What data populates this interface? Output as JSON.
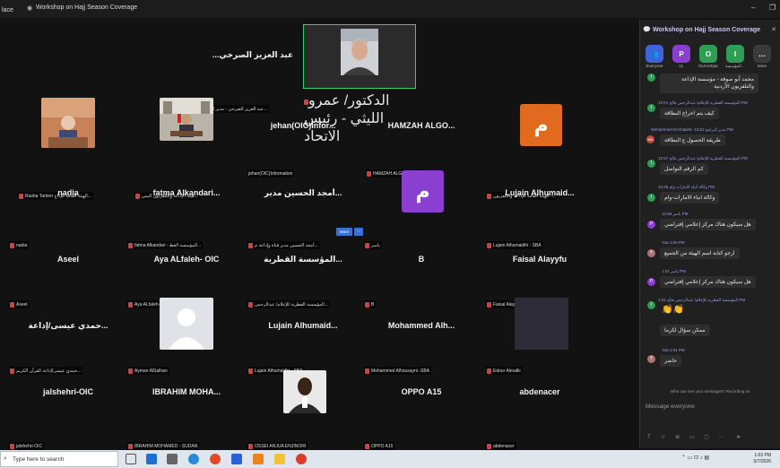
{
  "titlebar": {
    "app_name": "lace",
    "title": "Workshop on Hajj Season Coverage",
    "minimize": "–",
    "maximize": "❐"
  },
  "pinned": {
    "name": "الدكتور/ عمرو الليثي - رئيس الاتحاد"
  },
  "top_left": {
    "name": "...عبد العزيز الصرخي",
    "foot": "عبد العزيز الصرخي - مدير الشاد..."
  },
  "tiles": [
    {
      "id": "rasha",
      "name": "",
      "foot": "Rasha Tarteer الهيئة العامة للإذاع..."
    },
    {
      "id": "radio",
      "name": "",
      "foot": "هيئة الإذاعة والتلفزيون اليمن..."
    },
    {
      "id": "jehan",
      "name": "jehan(OIC)Infor...",
      "foot": "jehan(OIC)Information"
    },
    {
      "id": "hamzah",
      "name": "HAMZAH  ALGO...",
      "foot": "HAMZAH ALGOBAISHI"
    },
    {
      "id": "hayaa",
      "name": "",
      "foot": "الهيئة العامة للإذاعة والتلفزيون -..."
    },
    {
      "id": "nadia",
      "name": "nadia",
      "foot": "nadia"
    },
    {
      "id": "fatma",
      "name": "fatma  Alkandari...",
      "foot": "fatma Alkandari - المؤسسة العط..."
    },
    {
      "id": "amjad",
      "name": "أمجد الحسين مدير...",
      "foot": "أمجد الحسين مدير قناة وإذاعة م..."
    },
    {
      "id": "yasir",
      "name": "",
      "foot": "ياسر"
    },
    {
      "id": "lujain1",
      "name": "Lujain  Alhumaid...",
      "foot": "Lujain Alhumaidhi - SBA"
    },
    {
      "id": "aseel",
      "name": "Aseel",
      "foot": "Aseel"
    },
    {
      "id": "aya",
      "name": "Aya  ALfaleh-  OIC",
      "foot": "Aya ALfaleh- OIC"
    },
    {
      "id": "qatar",
      "name": "المؤسسة  القطرية...",
      "foot": "المؤسسة القطرية للإعلام/ عبدالرحمن..."
    },
    {
      "id": "b",
      "name": "B",
      "foot": "B"
    },
    {
      "id": "faisal",
      "name": "Faisal  Alayyfu",
      "foot": "Faisal Alayyfu"
    },
    {
      "id": "hamdi",
      "name": "حمدي  عيسى/إذاعة...",
      "foot": "حمدي عيسى/إذاعة القرآن الكريم..."
    },
    {
      "id": "ayman",
      "name": "",
      "foot": "Ayman AlSalhan"
    },
    {
      "id": "lujain2",
      "name": "Lujain  Alhumaid...",
      "foot": "Lujain Alhumaidhi - SBA"
    },
    {
      "id": "mohammed",
      "name": "Mohammed  Alh...",
      "foot": "Mohammed Alhousayni -SBA"
    },
    {
      "id": "edour",
      "name": "",
      "foot": "Edour Almalki"
    },
    {
      "id": "jalshehri",
      "name": "jalshehri-OIC",
      "foot": "jalshehri-OIC"
    },
    {
      "id": "ibrahim",
      "name": "IBRAHIM  MOHA...",
      "foot": "IBRAHIM MOHAMED - SUDAN"
    },
    {
      "id": "ossei",
      "name": "",
      "foot": "OSSEI ANJUA ENJINORI"
    },
    {
      "id": "oppo",
      "name": "OPPO  A15",
      "foot": "OPPO A15"
    },
    {
      "id": "abdenacer",
      "name": "abdenacer",
      "foot": "abdenacer"
    }
  ],
  "avatars": {
    "hayaa": "م",
    "yasir": "م"
  },
  "more_badge": "More",
  "panel": {
    "title": "Workshop on Hajj Season Coverage",
    "tabs": [
      {
        "letter": "",
        "label": "Everyone",
        "color": "#3f63d9"
      },
      {
        "letter": "P",
        "label": "يانا",
        "color": "#8a3fd1"
      },
      {
        "letter": "O",
        "label": "OUALIDjed...",
        "color": "#2e9e55"
      },
      {
        "letter": "I",
        "label": "المؤسسة ...",
        "color": "#2e9e55"
      },
      {
        "letter": "…",
        "label": "More",
        "color": "#3a3a3a"
      }
    ],
    "messages": [
      {
        "meta": "",
        "text": "محمد أبو صوفة - مؤسسة الإذاعة والتلفزيون الأردنية",
        "color": "#2e9e55",
        "letter": "I",
        "lines": 2
      },
      {
        "meta": "المؤسسة القطرية للإعلام/ عبدالرحمن فالح 12:01 PM",
        "text": "كيف يتم اخراج البطاقة",
        "color": "#2e9e55",
        "letter": "I"
      },
      {
        "meta": "Mohammed El Khatieb- مدير البرامج 12:01 PM",
        "text": "طريقة الحصول ع البطاقة",
        "color": "#c04a3a",
        "letter": "MK"
      },
      {
        "meta": "المؤسسة القطرية للإعلام/ عبدالرحمن فالح 12:57 PM",
        "text": "كم الرقم التواصل",
        "color": "#2e9e55",
        "letter": "I"
      },
      {
        "meta": "وكالة أنباء الامارات-وام 12:49 PM",
        "text": "وكالة انباء الامارات-وام",
        "color": "#2e9e55",
        "letter": "I"
      },
      {
        "meta": "ياسر 12:55 PM",
        "text": "هل سيكون هناك مركز إعلامي إفتراضي",
        "color": "#8a3fd1",
        "letter": "P"
      },
      {
        "meta": "Yoa 1:00 PM",
        "text": "ارجو كتابة اسم الهيئة من الجميع",
        "color": "#b07070",
        "letter": "Y"
      },
      {
        "meta": "ياسر 1:01 PM",
        "text": "هل سيكون هناك مركز إعلامي إفتراضي",
        "color": "#8a3fd1",
        "letter": "P"
      },
      {
        "meta": "المؤسسة القطرية للإعلام/ عبدالرحمن فالح 1:01 PM",
        "text": "👏👏",
        "color": "#2e9e55",
        "letter": "I"
      },
      {
        "meta": "",
        "text": "ممكن سؤال لكرما",
        "color": "#2e9e55",
        "letter": "I"
      },
      {
        "meta": "Yoa 1:01 PM",
        "text": "حاضر",
        "color": "#b07070",
        "letter": "Y"
      }
    ],
    "hint": "Who can see your messages? Recording on",
    "placeholder": "Message everyone"
  },
  "taskbar": {
    "search_placeholder": "Type here to search",
    "time": "1:03 PM",
    "date": "5/7/2026"
  }
}
